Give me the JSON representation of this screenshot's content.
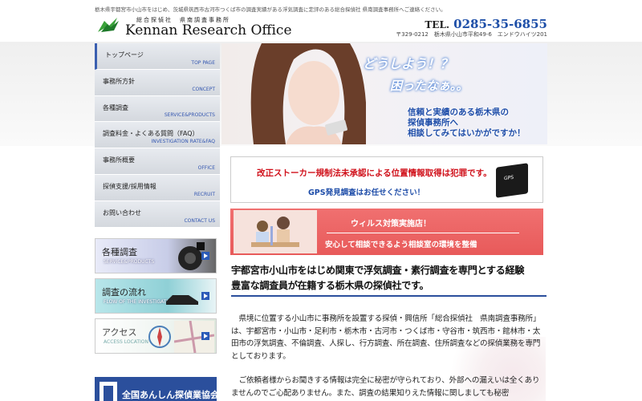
{
  "top_note": "栃木県宇都宮市小山市をはじめ、茨城県筑西市古河市つくば市の調査実績がある浮気調査に定評のある総合探偵社 県南調査事務所へご連絡ください。",
  "header": {
    "logo_small": "総合探偵社　県南調査事務所",
    "logo_main": "Kennan Research Office",
    "tel_label": "TEL.",
    "tel_number": "0285-35-6855",
    "address": "〒329-0212　栃木県小山市平和49-6　エンドウハイツ201"
  },
  "nav": {
    "items": [
      {
        "jp": "トップページ",
        "en": "TOP PAGE"
      },
      {
        "jp": "事務所方針",
        "en": "CONCEPT"
      },
      {
        "jp": "各種調査",
        "en": "SERVICE&PRODUCTS"
      },
      {
        "jp": "調査料金・よくある質問（FAQ）",
        "en": "INVESTIGATION RATE&FAQ"
      },
      {
        "jp": "事務所概要",
        "en": "OFFICE"
      },
      {
        "jp": "探偵支援/採用情報",
        "en": "RECRUIT"
      },
      {
        "jp": "お問い合わせ",
        "en": "CONTACT US"
      }
    ]
  },
  "side_banners": [
    {
      "title": "各種調査",
      "sub": "SERVICE&PRODUCTS"
    },
    {
      "title": "調査の流れ",
      "sub": "FLOW OF THE INVESTIGATION"
    },
    {
      "title": "アクセス",
      "sub": "ACCESS  LOCATION"
    }
  ],
  "association": "全国あんしん探偵業協会",
  "hero": {
    "q1": "どうしよう！？",
    "q2": "困ったなぁ。。",
    "msg1": "信頼と実績のある栃木県の",
    "msg2": "探偵事務所へ",
    "msg3": "相談してみてはいかがですか！"
  },
  "gps_banner": {
    "line1": "改正ストーカー規制法未承認による位置情報取得は犯罪です。",
    "line2": "GPS発見調査はお任せください！",
    "device": "GPS"
  },
  "virus_banner": {
    "line1": "ウィルス対策実施店！",
    "line2": "安心して相談できるよう相談室の環境を整備"
  },
  "headline": {
    "line1": "宇都宮市小山市をはじめ関東で浮気調査・素行調査を専門とする経験",
    "line2": "豊富な調査員が在籍する栃木県の探偵社です。"
  },
  "body": {
    "p1": "県境に位置する小山市に事務所を設置する探偵・興信所「総合探偵社　県南調査事務所」は、宇都宮市・小山市・足利市・栃木市・古河市・つくば市・守谷市・筑西市・館林市・太田市の浮気調査、不倫調査、人探し、行方調査、所在調査、住所調査などの探偵業務を専門としております。",
    "p2": "ご依頼者様からお聞きする情報は完全に秘密が守られており、外部への漏えいは全くありませんのでご心配ありません。また、調査の結果知りえた情報に関しましても秘密"
  },
  "colors": {
    "accent": "#2b4f9c",
    "tel": "#1e4fa8",
    "alert": "#d0101a",
    "virus_bg": "#e85a5a"
  }
}
